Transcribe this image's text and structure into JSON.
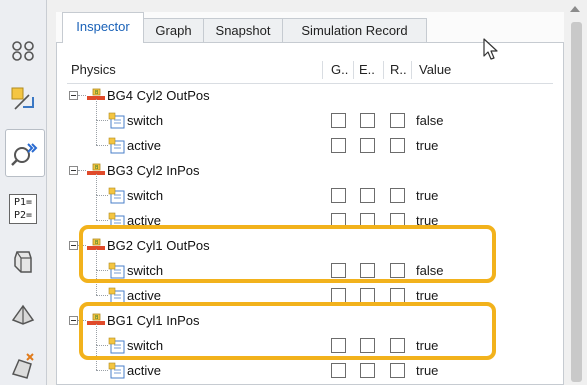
{
  "tabs": [
    {
      "label": "Inspector",
      "active": true
    },
    {
      "label": "Graph",
      "active": false
    },
    {
      "label": "Snapshot",
      "active": false
    },
    {
      "label": "Simulation Record",
      "active": false
    }
  ],
  "columns": [
    "Physics",
    "G..",
    "E..",
    "R..",
    "Value"
  ],
  "toolbar": [
    {
      "icon": "group-icon"
    },
    {
      "icon": "transform-icon"
    },
    {
      "icon": "inspector-icon",
      "active": true
    },
    {
      "icon": "p1-p2-label",
      "text_top": "P1=",
      "text_bottom": "P2="
    },
    {
      "icon": "component-icon"
    },
    {
      "icon": "part-icon"
    },
    {
      "icon": "assembly-icon"
    }
  ],
  "groups": [
    {
      "label": "BG4 Cyl2 OutPos",
      "children": [
        {
          "label": "switch",
          "value": "false"
        },
        {
          "label": "active",
          "value": "true"
        }
      ]
    },
    {
      "label": "BG3 Cyl2 InPos",
      "children": [
        {
          "label": "switch",
          "value": "true"
        },
        {
          "label": "active",
          "value": "true"
        }
      ]
    },
    {
      "label": "BG2 Cyl1 OutPos",
      "children": [
        {
          "label": "switch",
          "value": "false"
        },
        {
          "label": "active",
          "value": "true"
        }
      ]
    },
    {
      "label": "BG1 Cyl1 InPos",
      "children": [
        {
          "label": "switch",
          "value": "true"
        },
        {
          "label": "active",
          "value": "true"
        }
      ]
    }
  ],
  "colors": {
    "accent": "#1a62b8",
    "highlight": "#f2b21c"
  }
}
